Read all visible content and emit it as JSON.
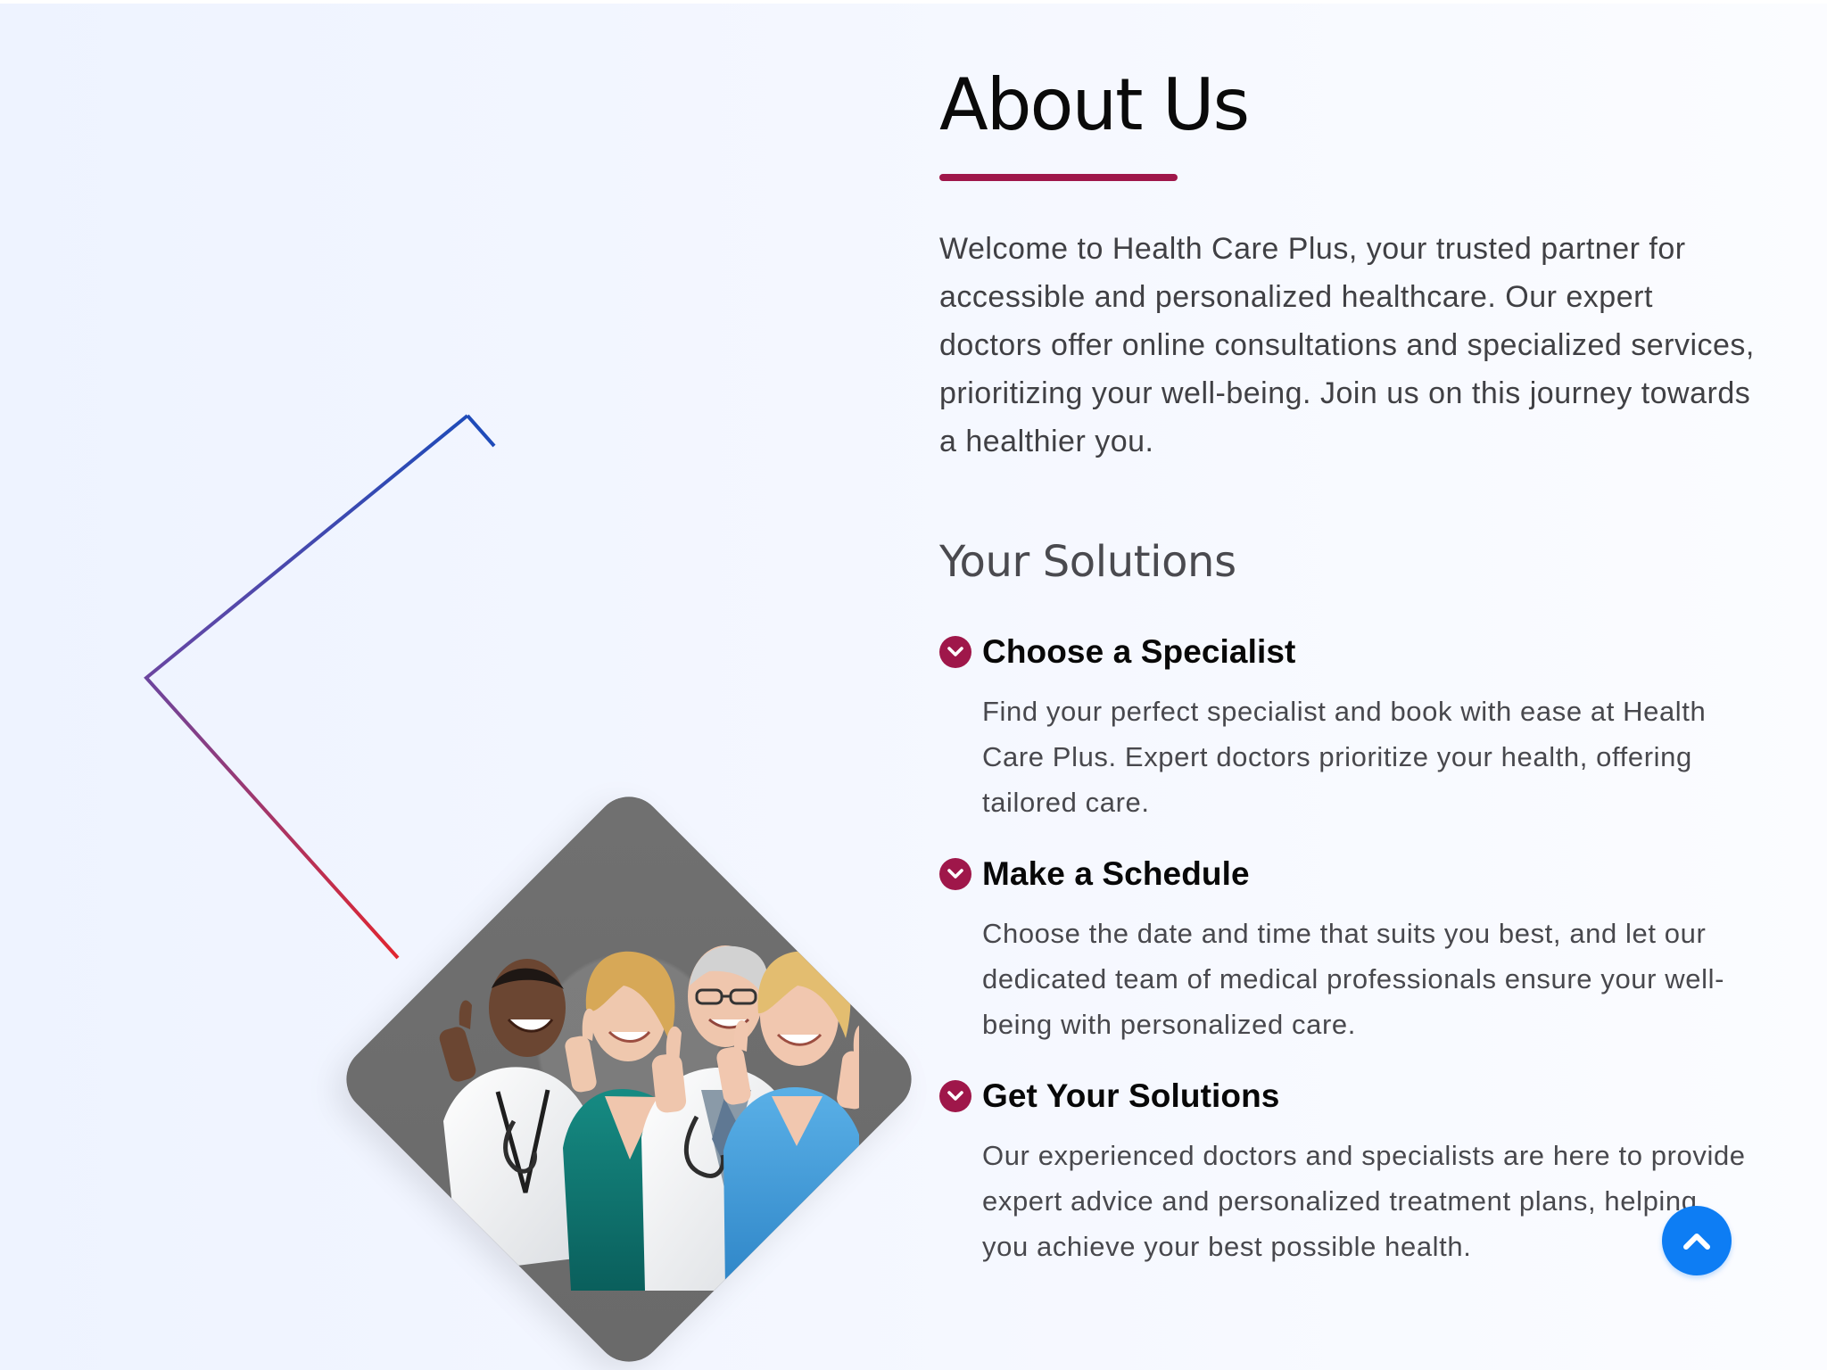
{
  "about": {
    "title": "About Us",
    "description": "Welcome to Health Care Plus, your trusted partner for accessible and personalized healthcare. Our expert doctors offer online consultations and specialized services, prioritizing your well-being. Join us on this journey towards a healthier you."
  },
  "solutions": {
    "title": "Your Solutions",
    "items": [
      {
        "title": "Choose a Specialist",
        "description": "Find your perfect specialist and book with ease at Health Care Plus. Expert doctors prioritize your health, offering tailored care.",
        "icon": "chevron-check-icon"
      },
      {
        "title": "Make a Schedule",
        "description": "Choose the date and time that suits you best, and let our dedicated team of medical professionals ensure your well-being with personalized care.",
        "icon": "chevron-check-icon"
      },
      {
        "title": "Get Your Solutions",
        "description": "Our experienced doctors and specialists are here to provide expert advice and personalized treatment plans, helping you achieve your best possible health.",
        "icon": "chevron-check-icon"
      }
    ]
  },
  "ui": {
    "scroll_top_icon": "chevron-up-icon",
    "accent_color": "#9f174a",
    "button_color": "#0d7df4",
    "outline_gradient": [
      "#1f4bb9",
      "#e1252f"
    ]
  }
}
